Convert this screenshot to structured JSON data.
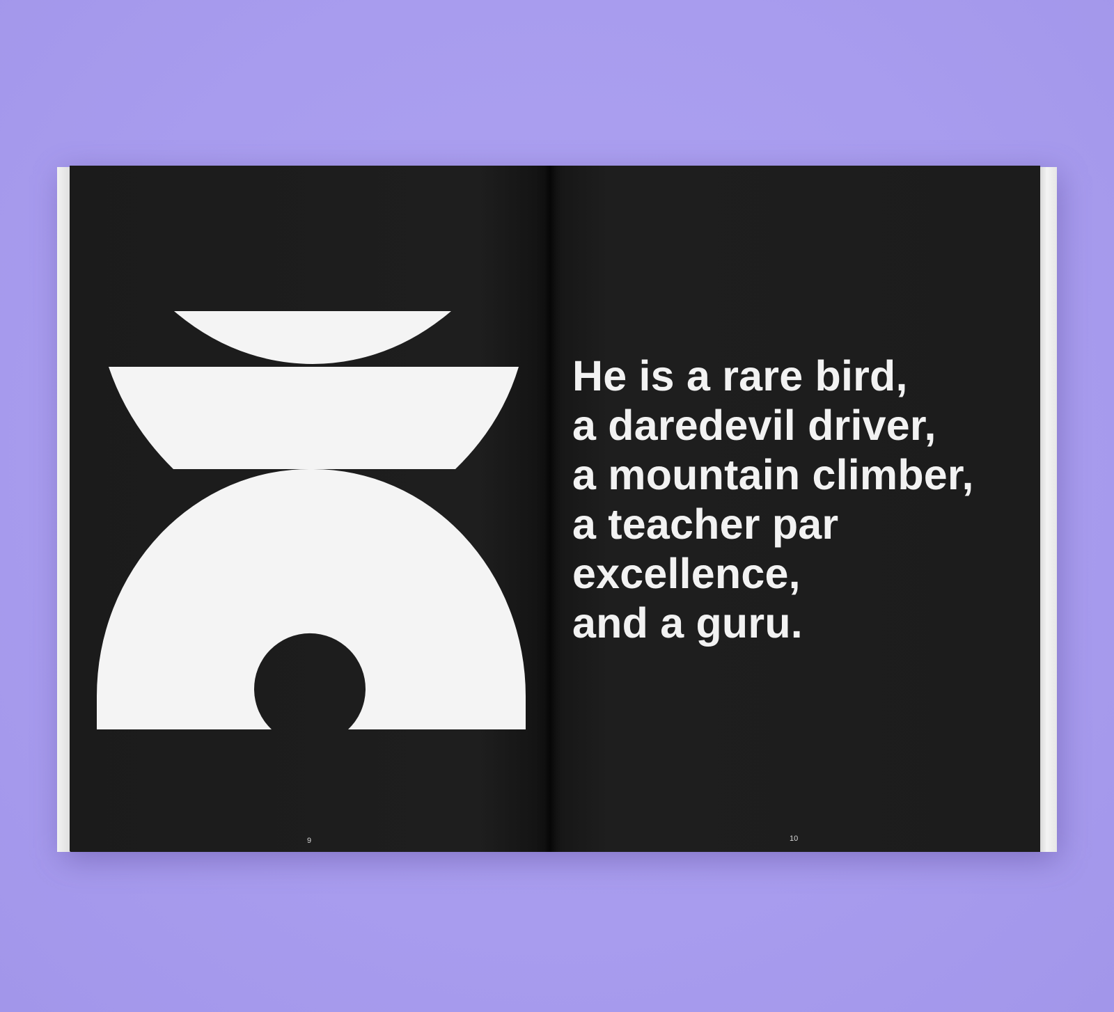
{
  "background_color": "#aa9ff0",
  "page_color": "#1d1d1d",
  "shape_color": "#f4f4f4",
  "illustration": {
    "shapes": [
      "top-bowl",
      "middle-bowl",
      "arch-with-hole"
    ]
  },
  "quote_lines": [
    "He is a rare bird,",
    "a daredevil driver,",
    "a mountain climber,",
    "a teacher par",
    "excellence,",
    "and a guru."
  ],
  "page_numbers": {
    "left": "9",
    "right": "10"
  }
}
